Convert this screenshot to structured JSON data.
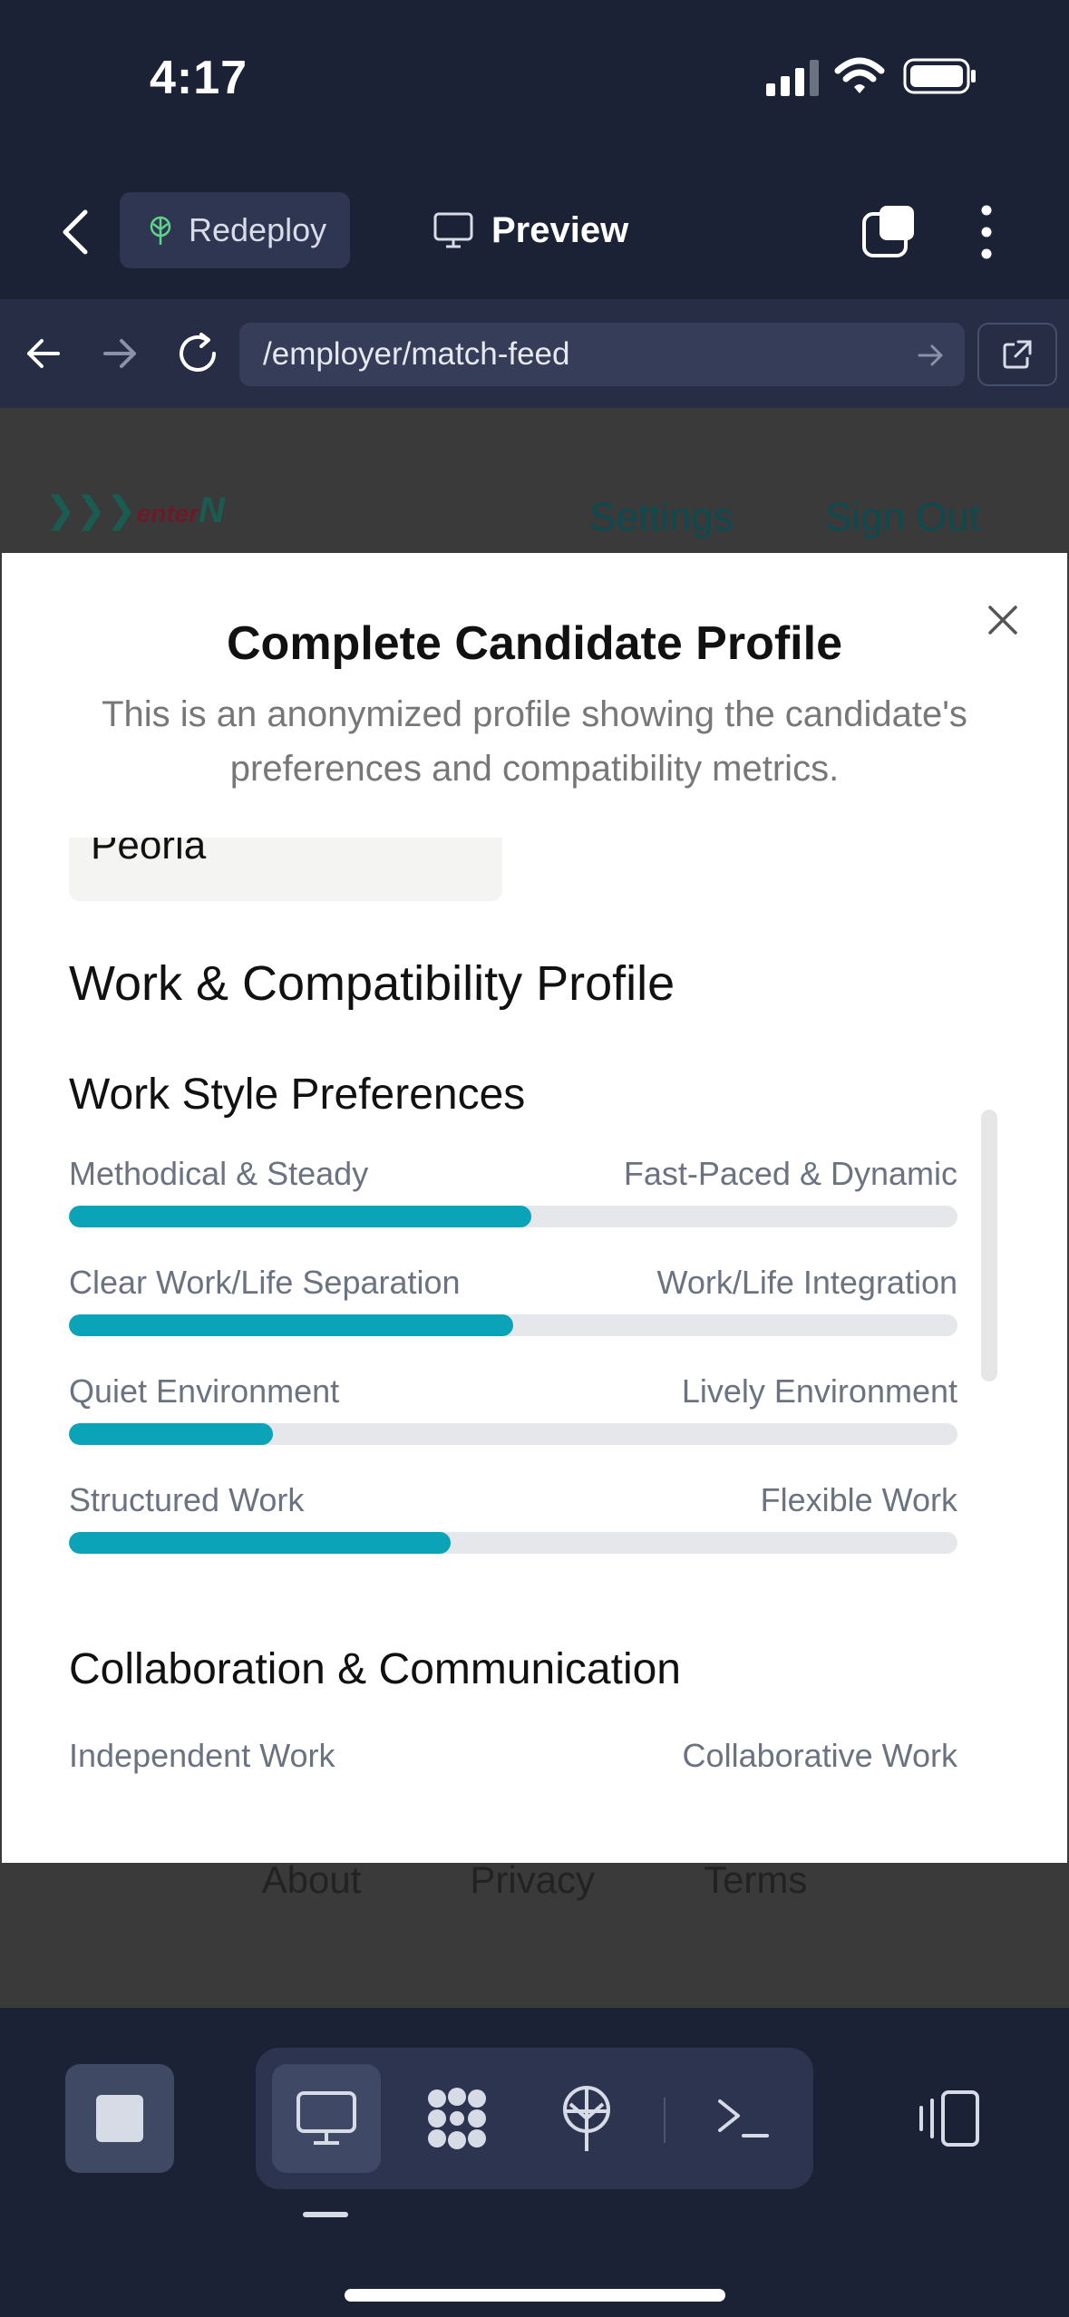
{
  "status_bar": {
    "time": "4:17"
  },
  "header": {
    "redeploy_label": "Redeploy",
    "preview_label": "Preview"
  },
  "browser": {
    "url": "/employer/match-feed"
  },
  "site": {
    "logo_text_a": "enter",
    "logo_text_b": "N",
    "nav": {
      "settings": "Settings",
      "sign_out": "Sign Out"
    },
    "footer": [
      "About",
      "Privacy",
      "Terms"
    ]
  },
  "modal": {
    "title": "Complete Candidate Profile",
    "description": "This is an anonymized profile showing the candidate's preferences and compatibility metrics.",
    "city_value": "Peoria",
    "section_title": "Work & Compatibility Profile",
    "work_style": {
      "title": "Work Style Preferences",
      "sliders": [
        {
          "left": "Methodical & Steady",
          "right": "Fast-Paced & Dynamic",
          "value": 0.52
        },
        {
          "left": "Clear Work/Life Separation",
          "right": "Work/Life Integration",
          "value": 0.5
        },
        {
          "left": "Quiet Environment",
          "right": "Lively Environment",
          "value": 0.23
        },
        {
          "left": "Structured Work",
          "right": "Flexible Work",
          "value": 0.43
        }
      ]
    },
    "collaboration": {
      "title": "Collaboration & Communication",
      "sliders": [
        {
          "left": "Independent Work",
          "right": "Collaborative Work"
        }
      ]
    }
  },
  "colors": {
    "accent": "#0ba3b8",
    "track": "#e5e7eb",
    "app_bg": "#1c2236"
  }
}
